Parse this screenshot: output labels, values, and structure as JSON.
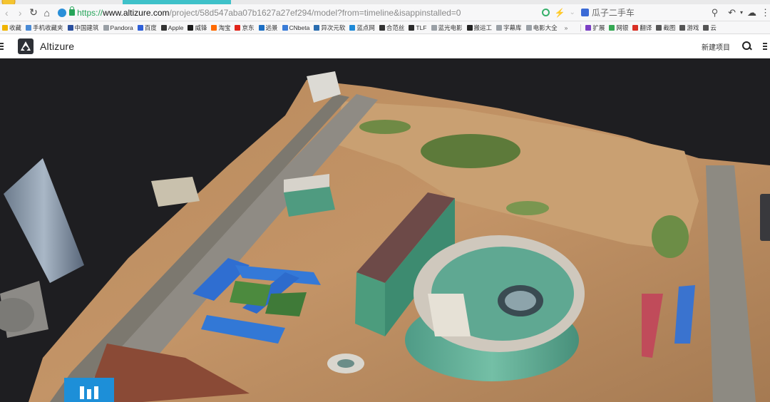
{
  "browser": {
    "url_scheme": "https://",
    "url_host": "www.altizure.com",
    "url_path": "/project/58d547aba07b1627a27ef294/model?from=timeline&isappinstalled=0",
    "search_suggestion": "瓜子二手车"
  },
  "bookmarks": {
    "left": [
      {
        "label": "收藏",
        "icon": "star-icon",
        "color": "#f0b400"
      },
      {
        "label": "手机收藏夹",
        "icon": "phone-icon",
        "color": "#4a8bd6"
      },
      {
        "label": "中国建筑",
        "icon": "building-icon",
        "color": "#2b4f9e"
      },
      {
        "label": "Pandora",
        "icon": "page-icon",
        "color": "#9aa0a6"
      },
      {
        "label": "百度",
        "icon": "baidu-icon",
        "color": "#2f5fd8"
      },
      {
        "label": "Apple",
        "icon": "apple-icon",
        "color": "#333333"
      },
      {
        "label": "威锋",
        "icon": "weifeng-icon",
        "color": "#1a1a1a"
      },
      {
        "label": "淘宝",
        "icon": "taobao-icon",
        "color": "#ff6a00"
      },
      {
        "label": "京东",
        "icon": "jd-icon",
        "color": "#e1251b"
      },
      {
        "label": "远景",
        "icon": "yuanjing-icon",
        "color": "#1c6fc4"
      },
      {
        "label": "CNbeta",
        "icon": "cnbeta-icon",
        "color": "#3b7dd8"
      },
      {
        "label": "异次元软",
        "icon": "iplaysoft-icon",
        "color": "#2a6db0"
      },
      {
        "label": "蓝点网",
        "icon": "landian-icon",
        "color": "#1f8ad8"
      },
      {
        "label": "合范丝",
        "icon": "hefansi-icon",
        "color": "#333333"
      },
      {
        "label": "TLF",
        "icon": "tlf-icon",
        "color": "#2c2c2c"
      },
      {
        "label": "蓝光电影",
        "icon": "page-icon",
        "color": "#9aa0a6"
      },
      {
        "label": "搬运工",
        "icon": "banyun-icon",
        "color": "#222222"
      },
      {
        "label": "字幕库",
        "icon": "page-icon",
        "color": "#9aa0a6"
      },
      {
        "label": "电影大全",
        "icon": "page-icon",
        "color": "#9aa0a6"
      }
    ],
    "more": "»",
    "right": [
      {
        "label": "扩展",
        "icon": "extension-icon",
        "color": "#7b3fc4"
      },
      {
        "label": "网银",
        "icon": "bank-icon",
        "color": "#35a853"
      },
      {
        "label": "翻译",
        "icon": "translate-icon",
        "color": "#d93025"
      },
      {
        "label": "截图",
        "icon": "scissors-icon",
        "color": "#555555"
      },
      {
        "label": "游戏",
        "icon": "game-icon",
        "color": "#555555"
      },
      {
        "label": "云",
        "icon": "cloud-icon",
        "color": "#555555"
      }
    ]
  },
  "app": {
    "brand": "Altizure",
    "new_project": "新建项目"
  },
  "colors": {
    "accent_blue": "#1d8fd8",
    "address_green": "#27a55a",
    "viewport_bg": "#1e1e21"
  }
}
